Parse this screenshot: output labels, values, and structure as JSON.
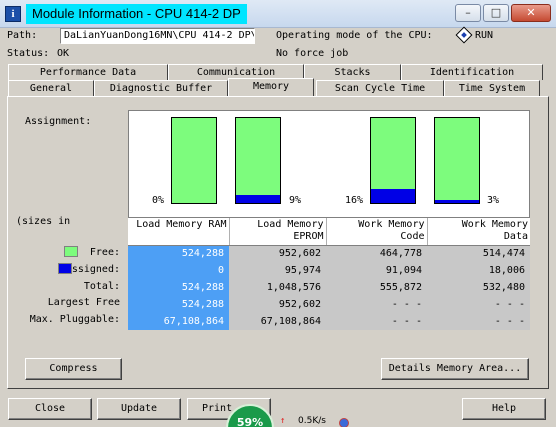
{
  "window": {
    "title": "Module Information - CPU 414-2 DP",
    "minimize": "–",
    "maximize": "□",
    "close": "✕"
  },
  "header": {
    "path_label": "Path:",
    "path_value": "DaLianYuanDong16MN\\CPU 414-2 DP\\",
    "status_label": "Status:",
    "status_value": "OK",
    "opmode_label": "Operating mode of the  CPU:",
    "opmode_value": "RUN",
    "force_text": "No force job"
  },
  "tabs_row1": [
    "Performance Data",
    "Communication",
    "Stacks",
    "Identification"
  ],
  "tabs_row2": [
    "General",
    "Diagnostic Buffer",
    "Memory",
    "Scan Cycle Time",
    "Time System"
  ],
  "memory": {
    "assignment_label": "Assignment:",
    "sizes_label": "(sizes in",
    "bars": [
      {
        "used_fraction": 0.0,
        "pct": "0%"
      },
      {
        "used_fraction": 0.09,
        "pct": "9%"
      },
      {
        "used_fraction": 0.16,
        "pct": "16%"
      },
      {
        "used_fraction": 0.03,
        "pct": "3%"
      }
    ],
    "colors": {
      "free": "#7dfc7d",
      "used": "#0000e6"
    },
    "columns": [
      "Load Memory RAM",
      "Load Memory\nEPROM",
      "Work Memory\nCode",
      "Work Memory\nData"
    ],
    "row_labels": [
      "Free:",
      "ssigned:",
      "Total:",
      "Largest Free",
      "Max. Pluggable:"
    ],
    "rows": [
      [
        "524,288",
        "952,602",
        "464,778",
        "514,474"
      ],
      [
        "0",
        "95,974",
        "91,094",
        "18,006"
      ],
      [
        "524,288",
        "1,048,576",
        "555,872",
        "532,480"
      ],
      [
        "524,288",
        "952,602",
        "- - -",
        "- - -"
      ],
      [
        "67,108,864",
        "67,108,864",
        "- - -",
        "- - -"
      ]
    ]
  },
  "buttons": {
    "compress": "Compress",
    "details": "Details Memory Area...",
    "close": "Close",
    "update": "Update",
    "print": "Print",
    "help": "Help"
  },
  "overlay": {
    "badge": "59%",
    "speed": "0.5K/s",
    "arrow": "↑"
  }
}
